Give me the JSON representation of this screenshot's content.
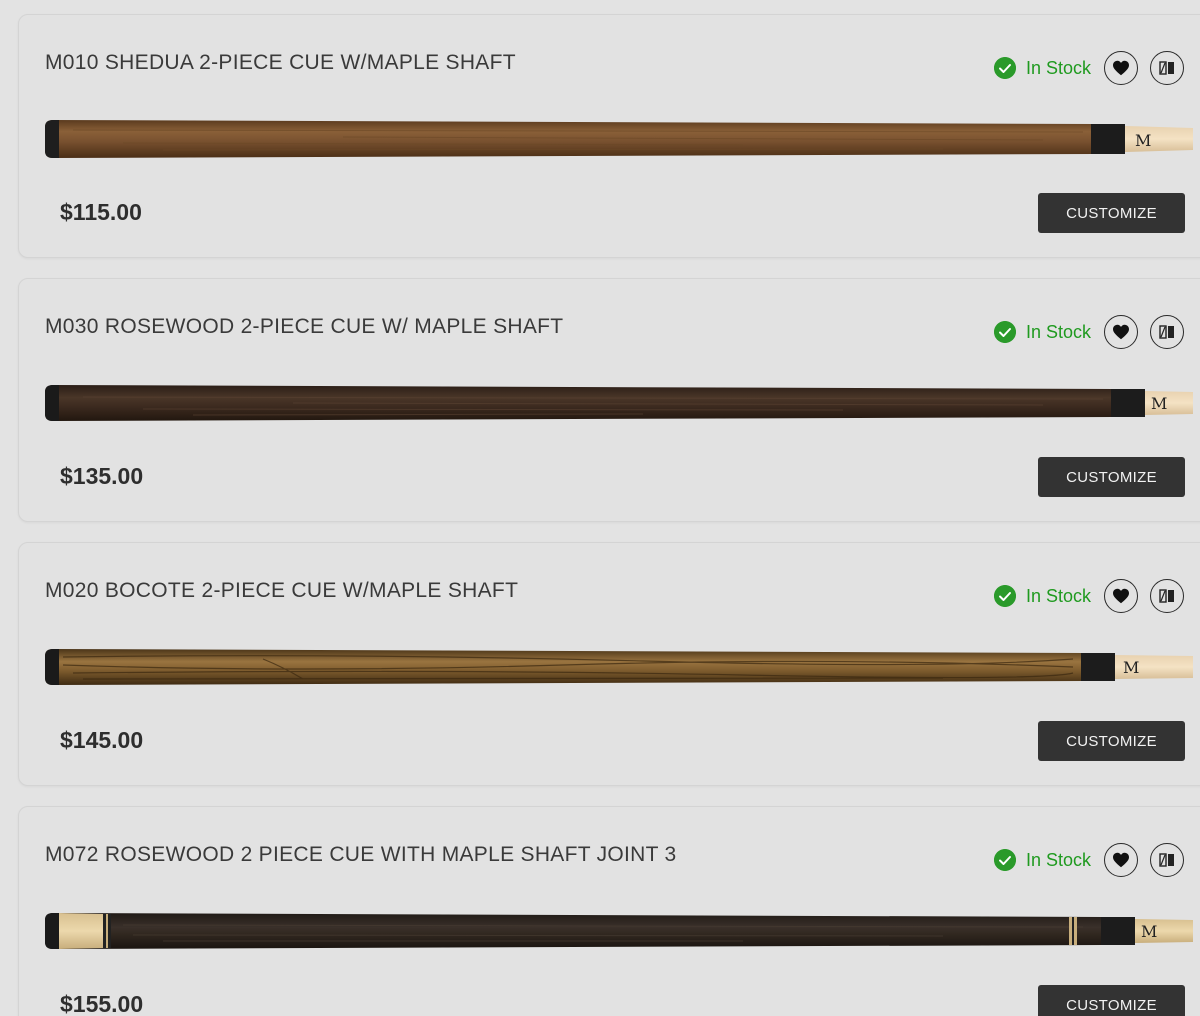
{
  "colors": {
    "stock_green": "#1f9a1f",
    "button_dark": "#333333",
    "page_bg": "#e3e3e3"
  },
  "icons": {
    "stock": "check-circle-icon",
    "favorite": "heart-icon",
    "compare": "compare-icon"
  },
  "products": [
    {
      "title": "M010 SHEDUA 2-PIECE CUE W/MAPLE SHAFT",
      "stock": "In Stock",
      "price": "$115.00",
      "button": "CUSTOMIZE",
      "wood": "shedua"
    },
    {
      "title": "M030 ROSEWOOD 2-PIECE CUE W/ MAPLE SHAFT",
      "stock": "In Stock",
      "price": "$135.00",
      "button": "CUSTOMIZE",
      "wood": "rosewood"
    },
    {
      "title": "M020 BOCOTE 2-PIECE CUE W/MAPLE SHAFT",
      "stock": "In Stock",
      "price": "$145.00",
      "button": "CUSTOMIZE",
      "wood": "bocote"
    },
    {
      "title": "M072 ROSEWOOD 2 PIECE CUE WITH MAPLE SHAFT JOINT 3",
      "stock": "In Stock",
      "price": "$155.00",
      "button": "CUSTOMIZE",
      "wood": "rosewood-dark"
    }
  ]
}
